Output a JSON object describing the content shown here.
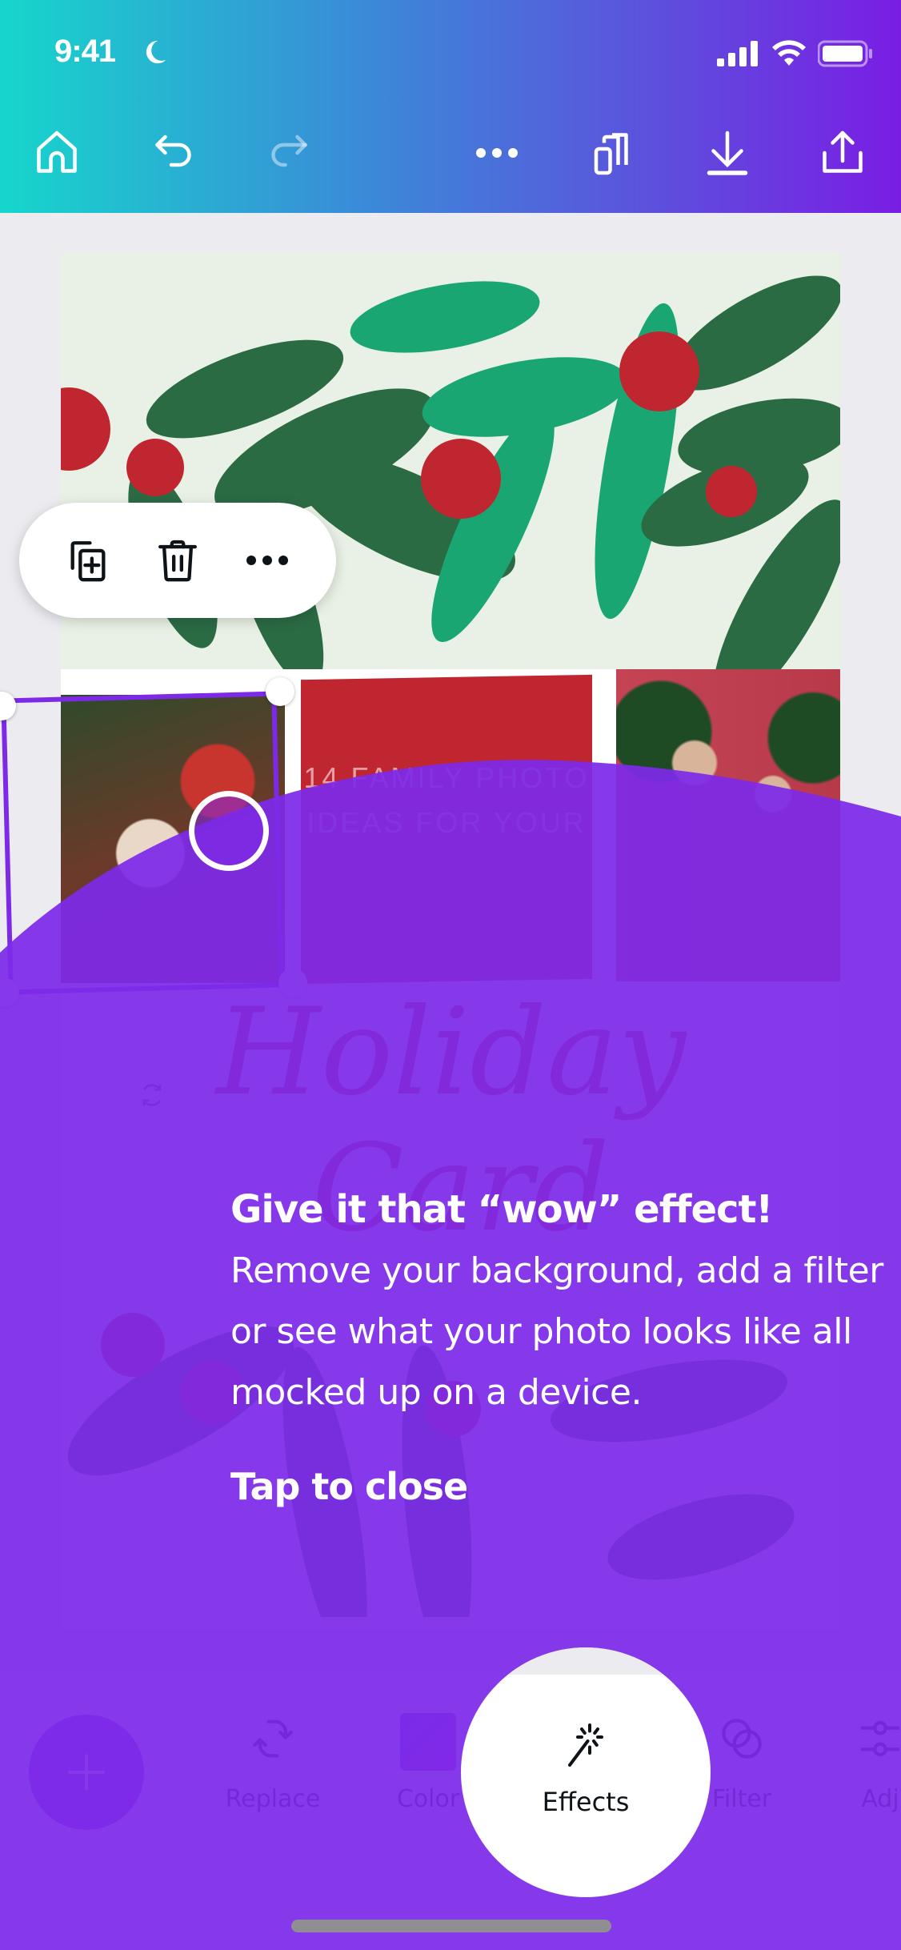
{
  "status_bar": {
    "time": "9:41",
    "icons": [
      "moon-icon",
      "signal-icon",
      "wifi-icon",
      "battery-icon"
    ]
  },
  "top_toolbar": {
    "items": [
      {
        "name": "home",
        "icon": "home-icon",
        "enabled": true
      },
      {
        "name": "undo",
        "icon": "undo-icon",
        "enabled": true
      },
      {
        "name": "redo",
        "icon": "redo-icon",
        "enabled": false
      },
      {
        "name": "more",
        "icon": "more-icon",
        "enabled": true
      },
      {
        "name": "pages",
        "icon": "pages-icon",
        "enabled": true
      },
      {
        "name": "download",
        "icon": "download-icon",
        "enabled": true
      },
      {
        "name": "share",
        "icon": "share-icon",
        "enabled": true
      }
    ]
  },
  "context_menu": {
    "items": [
      {
        "name": "duplicate",
        "icon": "duplicate-icon"
      },
      {
        "name": "delete",
        "icon": "trash-icon"
      },
      {
        "name": "more",
        "icon": "more-icon"
      }
    ]
  },
  "canvas": {
    "tile_text": "14 FAMILY PHOTO IDEAS FOR YOUR",
    "title_line1": "Holiday",
    "title_line2": "Card"
  },
  "bottom_toolbar": {
    "add_icon": "plus-icon",
    "tools": [
      {
        "label": "Replace",
        "icon": "replace-icon"
      },
      {
        "label": "Color",
        "icon": "color-swatch-icon"
      },
      {
        "label": "Effects",
        "icon": "magic-wand-icon",
        "highlighted": true
      },
      {
        "label": "Filter",
        "icon": "filter-icon"
      },
      {
        "label": "Adj",
        "icon": "sliders-icon"
      }
    ]
  },
  "tooltip": {
    "title": "Give it that “wow” effect!",
    "body": "Remove your background, add a filter or see what your photo looks like all mocked up on a device.",
    "close_label": "Tap to close"
  },
  "colors": {
    "overlay": "#7d2ae8",
    "header_start": "#16d6cc",
    "header_end": "#7a1de4",
    "berry_red": "#c0262f",
    "leaf_dark": "#2b6b44",
    "leaf_light": "#1aa673"
  }
}
